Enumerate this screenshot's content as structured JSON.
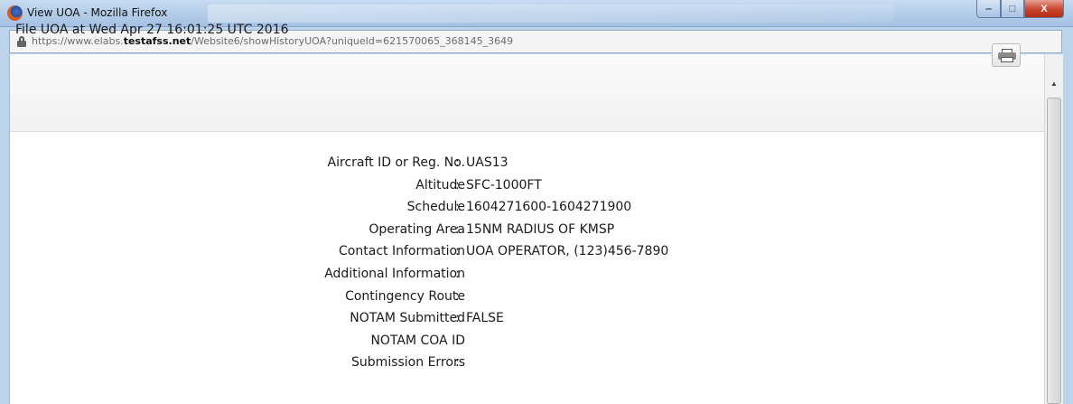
{
  "window": {
    "title": "View UOA - Mozilla Firefox",
    "controls": {
      "minimize": "‒",
      "maximize": "□",
      "close": "X"
    }
  },
  "address_bar": {
    "url_prefix": "https://www.elabs.",
    "url_domain": "testafss.net",
    "url_path": "/Website6/showHistoryUOA?uniqueId=621570065_368145_3649"
  },
  "dialog": {
    "title": "File UOA at Wed Apr 27 16:01:25 UTC 2016"
  },
  "details": {
    "separator": ":",
    "fields": [
      {
        "label": "Aircraft ID or Reg. No.",
        "value": "UAS13"
      },
      {
        "label": "Altitude",
        "value": "SFC-1000FT"
      },
      {
        "label": "Schedule",
        "value": "1604271600-1604271900"
      },
      {
        "label": "Operating Area",
        "value": "15NM RADIUS OF KMSP"
      },
      {
        "label": "Contact Information",
        "value": "UOA OPERATOR, (123)456-7890"
      },
      {
        "label": "Additional Information",
        "value": ""
      },
      {
        "label": "Contingency Route",
        "value": ""
      },
      {
        "label": "NOTAM Submitted",
        "value": "FALSE"
      },
      {
        "label": "NOTAM COA ID",
        "value": ""
      },
      {
        "label": "Submission Errors",
        "value": ""
      }
    ]
  }
}
